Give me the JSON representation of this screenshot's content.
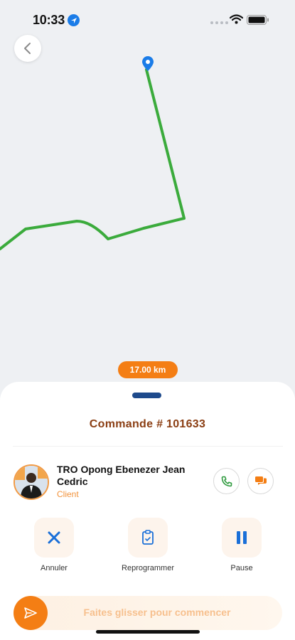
{
  "status_bar": {
    "time": "10:33"
  },
  "map": {
    "distance": "17.00 km"
  },
  "order": {
    "title": "Commande # 101633"
  },
  "client": {
    "name": "TRO Opong Ebenezer Jean Cedric",
    "role": "Client"
  },
  "actions": [
    {
      "label": "Annuler",
      "icon": "close-icon"
    },
    {
      "label": "Reprogrammer",
      "icon": "clipboard-icon"
    },
    {
      "label": "Pause",
      "icon": "pause-icon"
    }
  ],
  "slider": {
    "label": "Faites glisser pour commencer"
  },
  "colors": {
    "accent": "#f47e14",
    "route": "#3bab3c",
    "primary": "#1e4a8c",
    "title": "#8a3d12"
  }
}
